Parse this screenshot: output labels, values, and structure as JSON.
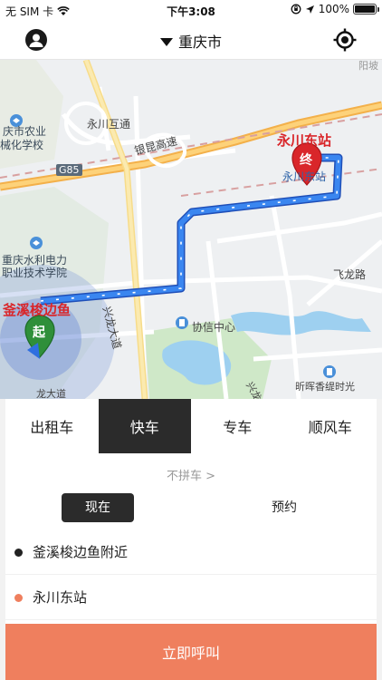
{
  "status_bar": {
    "carrier": "无 SIM 卡",
    "time": "下午3:08",
    "battery": "100%",
    "battery_level": 1.0
  },
  "nav": {
    "city": "重庆市"
  },
  "map": {
    "labels": {
      "yongchuan_interchange": "永川互通",
      "yinkun_expressway": "银昆高速",
      "g85": "G85",
      "college_top_1": "庆市农业",
      "college_top_2": "械化学校",
      "college_mid_1": "重庆水利电力",
      "college_mid_2": "职业技术学院",
      "xinglong_avenue": "兴龙大道",
      "xiexin_center": "协信中心",
      "feilong_road": "飞龙路",
      "xinhui_hotel": "昕晖香缇时光",
      "yongchuan_east_small": "永川东站",
      "start_place": "釜溪梭边鱼",
      "end_place": "永川东站",
      "start_marker": "起",
      "end_marker": "终",
      "road_fragment_1": "兴龙",
      "road_fragment_2": "龙大道",
      "top_right_fragment": "阳坡"
    }
  },
  "tabs": [
    "出租车",
    "快车",
    "专车",
    "顺风车"
  ],
  "active_tab": "快车",
  "carpool": "不拼车 >",
  "time_options": {
    "now": "现在",
    "later": "预约"
  },
  "pickup": "釜溪梭边鱼附近",
  "destination": "永川东站",
  "call_button": "立即呼叫",
  "colors": {
    "route": "#2f6fe0",
    "pickup_dot": "#222222",
    "destination_dot": "#ef7f5e",
    "call_button": "#ef7f5e",
    "active_tab": "#2b2b2b"
  }
}
